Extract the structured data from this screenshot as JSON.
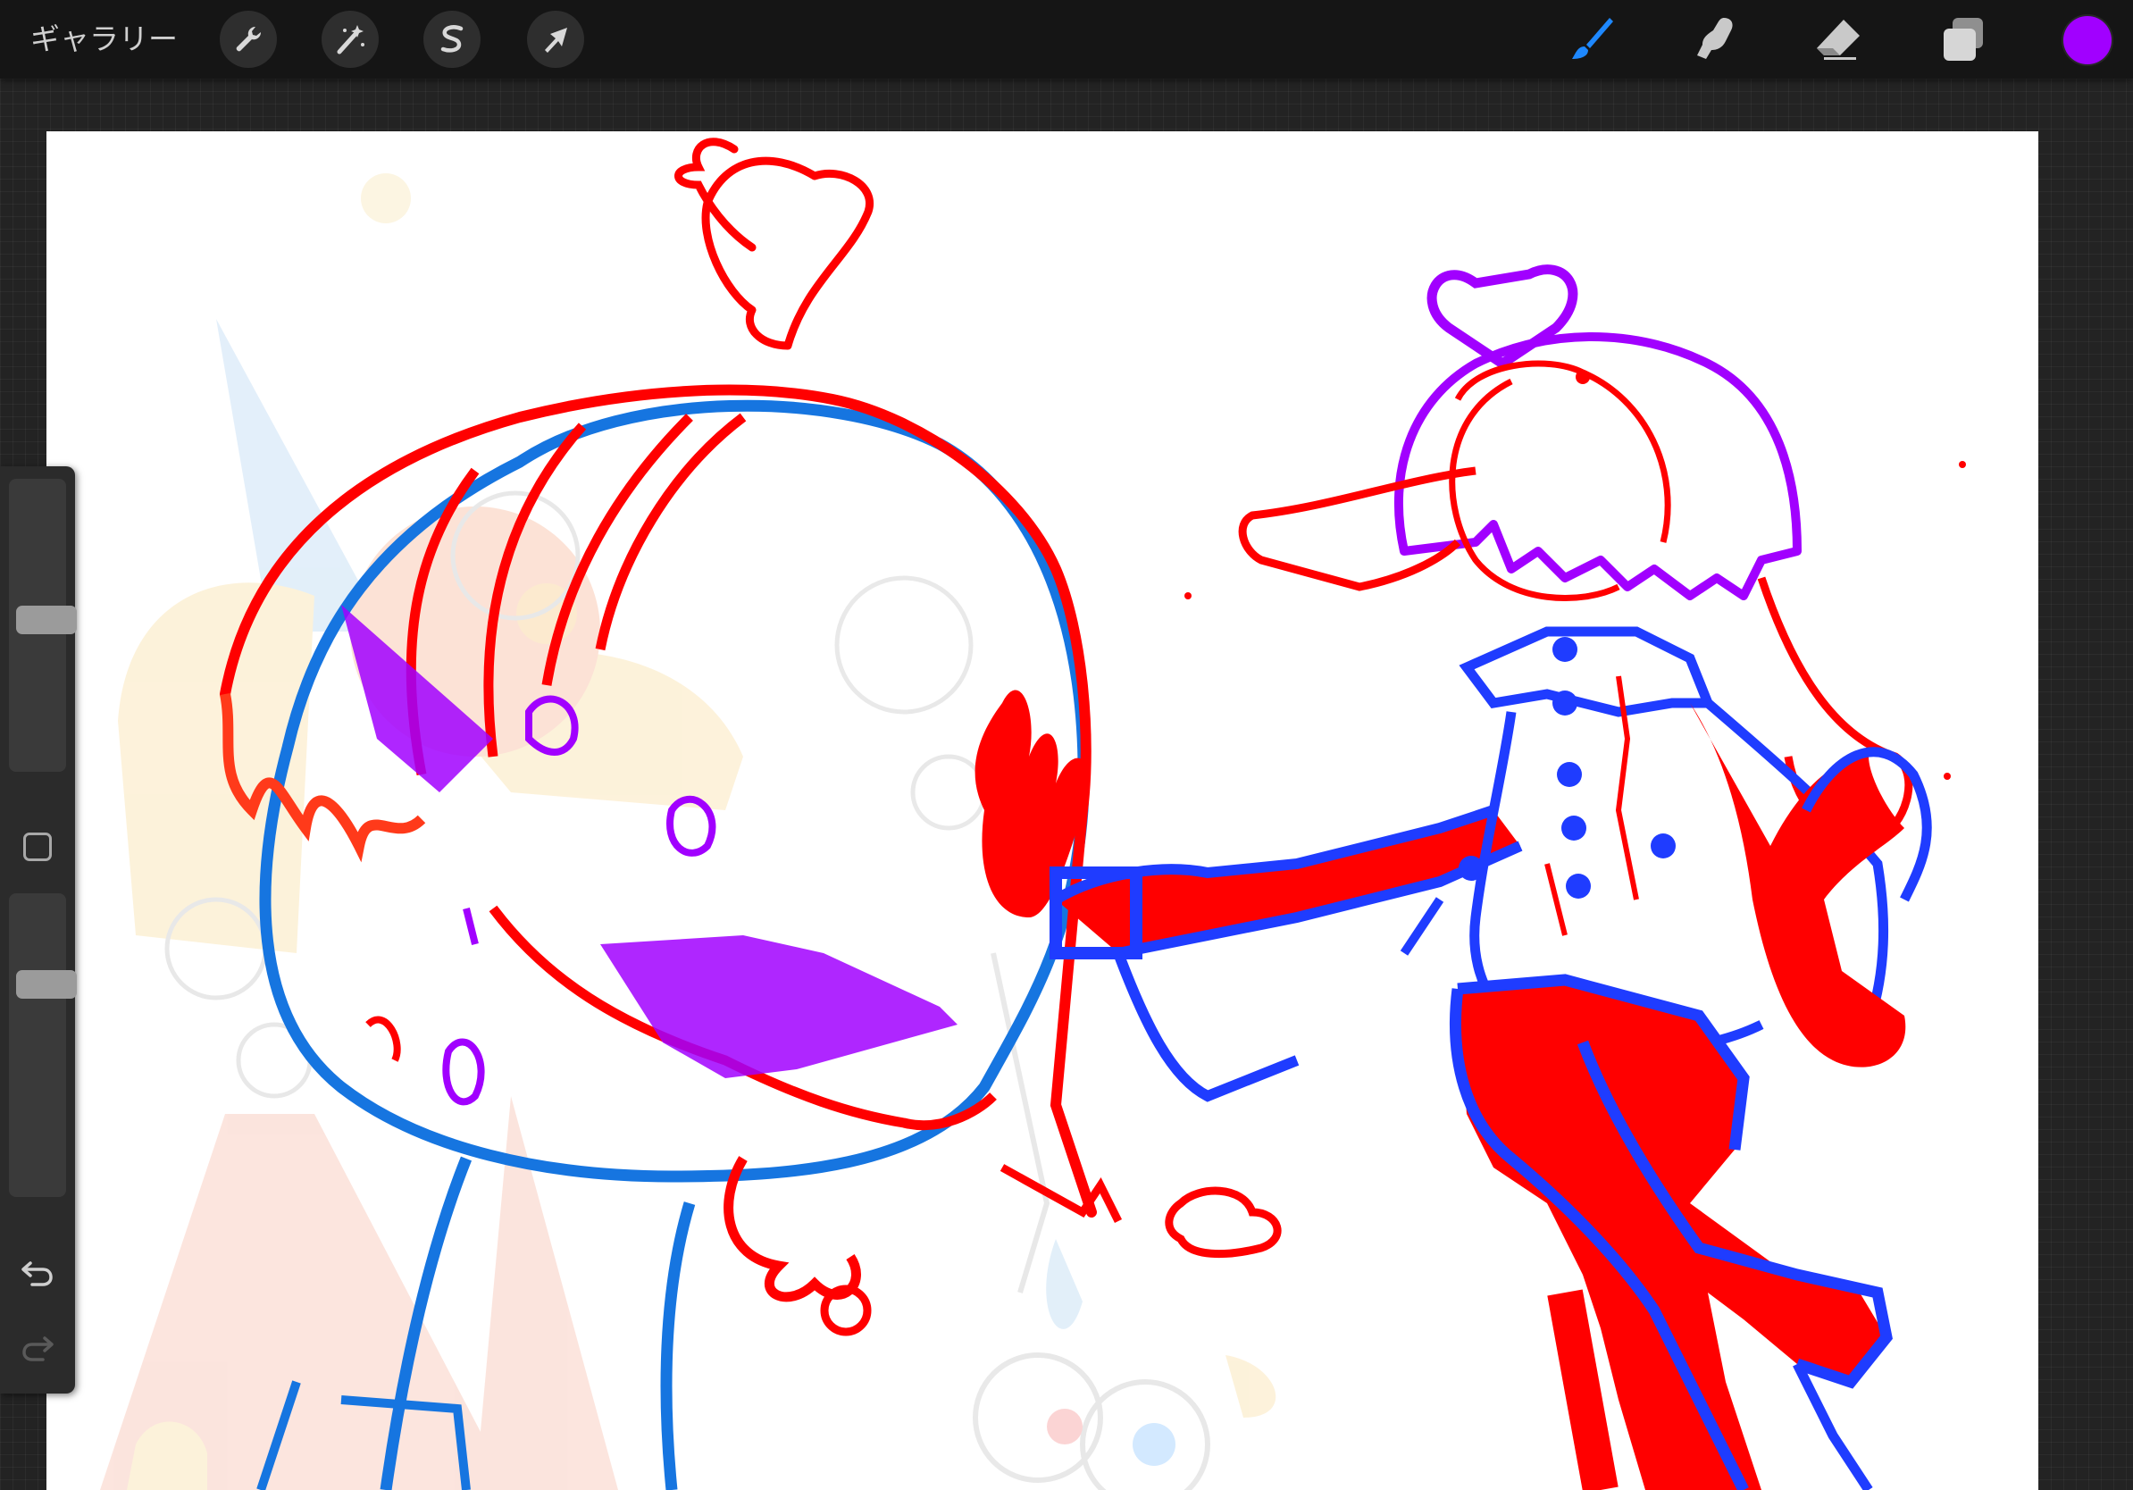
{
  "topbar": {
    "gallery_label": "ギャラリー",
    "tools_left": [
      {
        "name": "actions",
        "icon": "wrench-icon"
      },
      {
        "name": "adjustments",
        "icon": "magic-wand-icon"
      },
      {
        "name": "selection",
        "icon": "selection-s-icon"
      },
      {
        "name": "transform",
        "icon": "arrow-cursor-icon"
      }
    ],
    "tools_right": [
      {
        "name": "brush",
        "icon": "brush-icon",
        "active": true
      },
      {
        "name": "smudge",
        "icon": "smudge-finger-icon",
        "active": false
      },
      {
        "name": "eraser",
        "icon": "eraser-icon",
        "active": false
      },
      {
        "name": "layers",
        "icon": "layers-icon",
        "active": false
      }
    ],
    "current_color": "#a100ff"
  },
  "sidebar": {
    "brush_size_level": 0.52,
    "opacity_level": 0.72,
    "modify_icon": "square-icon",
    "undo_icon": "undo-arrow-icon",
    "redo_icon": "redo-arrow-icon"
  },
  "colors": {
    "active_tool": "#1e88ff",
    "sketch_red": "#ff0000",
    "sketch_blue": "#1f3cff",
    "sketch_light_blue": "#1675e0",
    "sketch_purple": "#a100ff"
  }
}
